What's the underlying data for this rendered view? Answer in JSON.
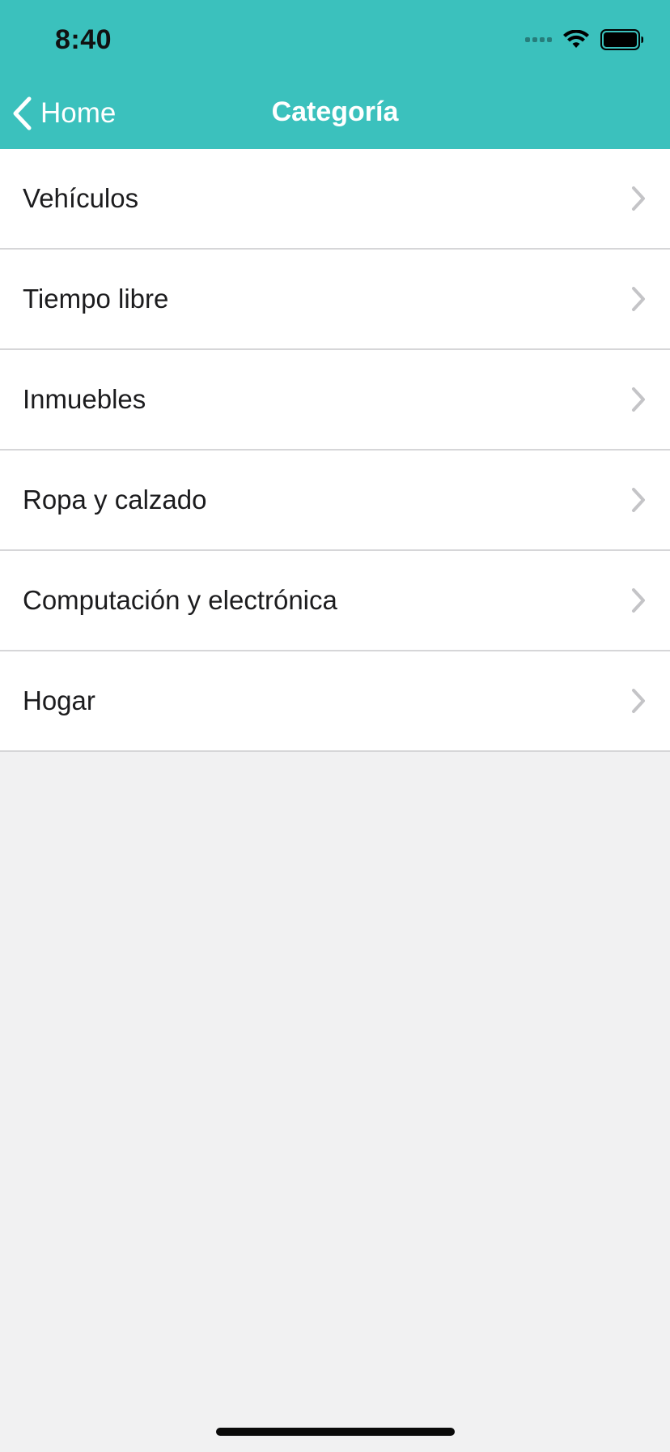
{
  "status_bar": {
    "time": "8:40",
    "icons": [
      "signal-icon",
      "wifi-icon",
      "battery-icon"
    ]
  },
  "nav": {
    "back_label": "Home",
    "title": "Categoría"
  },
  "categories": [
    {
      "label": "Vehículos"
    },
    {
      "label": "Tiempo libre"
    },
    {
      "label": "Inmuebles"
    },
    {
      "label": "Ropa y calzado"
    },
    {
      "label": "Computación y electrónica"
    },
    {
      "label": "Hogar"
    }
  ],
  "colors": {
    "header": "#3bc1bd",
    "background": "#f1f1f2",
    "separator": "#d6d6d8",
    "chevron": "#c4c4c7"
  }
}
